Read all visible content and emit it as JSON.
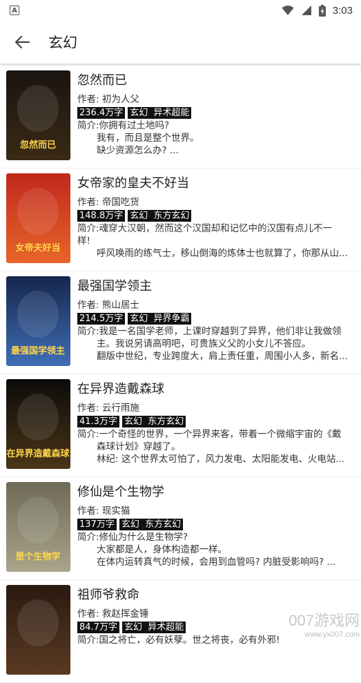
{
  "status": {
    "time": "3:03"
  },
  "appbar": {
    "title": "玄幻"
  },
  "books": [
    {
      "title": "忽然而已",
      "author": "作者: 初为人父",
      "words": "236.4万字",
      "tags": "玄幻  异术超能",
      "intro": [
        "简介:你拥有过土地吗?",
        "我有，而且是整个世界。",
        "缺少资源怎么办? ..."
      ],
      "cover_text": "忽然而已",
      "cover_colors": [
        "#1a1410",
        "#3a2a16"
      ]
    },
    {
      "title": "女帝家的皇夫不好当",
      "author": "作者: 帝国吃货",
      "words": "148.8万字",
      "tags": "玄幻  东方玄幻",
      "intro": [
        "简介:魂穿大汉朝，然而这个汉国却和记忆中的汉国有点儿不一",
        "样!",
        "呼风唤雨的练气士，移山倒海的炼体士也就算了，你那从山..."
      ],
      "cover_text": "女帝夫好当",
      "cover_colors": [
        "#c0281c",
        "#e8652a"
      ]
    },
    {
      "title": "最强国学领主",
      "author": "作者: 熊山居士",
      "words": "214.5万字",
      "tags": "玄幻  异界争霸",
      "intro": [
        "简介:我是一名国学老师，上课时穿越到了异界，他们非让我做领",
        "主。我说另请高明吧，可贵族义父的小女儿不答应。",
        "翻版中世纪，专业跨度大，肩上责任重，周围小人多，新名..."
      ],
      "cover_text": "最强国学领主",
      "cover_colors": [
        "#16264e",
        "#3f6fb5"
      ]
    },
    {
      "title": "在异界造戴森球",
      "author": "作者: 云行雨施",
      "words": "41.3万字",
      "tags": "玄幻  东方玄幻",
      "intro": [
        "简介:一个奇怪的世界，一个异界来客，带着一个微缩宇宙的《戴",
        "森球计划》穿越了。",
        "林纪: 这个世界太可怕了，风力发电、太阳能发电、火电站..."
      ],
      "cover_text": "在异界造戴森球",
      "cover_colors": [
        "#0c0b0a",
        "#4a3516"
      ]
    },
    {
      "title": "修仙是个生物学",
      "author": "作者: 现实猫",
      "words": "137万字",
      "tags": "玄幻  东方玄幻",
      "intro": [
        "简介:修仙为什么是生物学?",
        "大家都是人，身体构造都一样。",
        "在体内运转真气的时候，会用到血管吗? 内脏受影响吗? ..."
      ],
      "cover_text": "是个生物学",
      "cover_colors": [
        "#6e6a55",
        "#a9a48a"
      ]
    },
    {
      "title": "祖师爷救命",
      "author": "作者: 救赵挥金锤",
      "words": "84.7万字",
      "tags": "玄幻  异术超能",
      "intro": [
        "简介:国之将亡，必有妖孽。世之将丧，必有外邪!",
        "",
        ""
      ],
      "cover_text": "",
      "cover_colors": [
        "#2a1a10",
        "#5a3a22"
      ]
    }
  ],
  "watermark": {
    "big": "007游戏网",
    "small": "www.yx007.com"
  }
}
